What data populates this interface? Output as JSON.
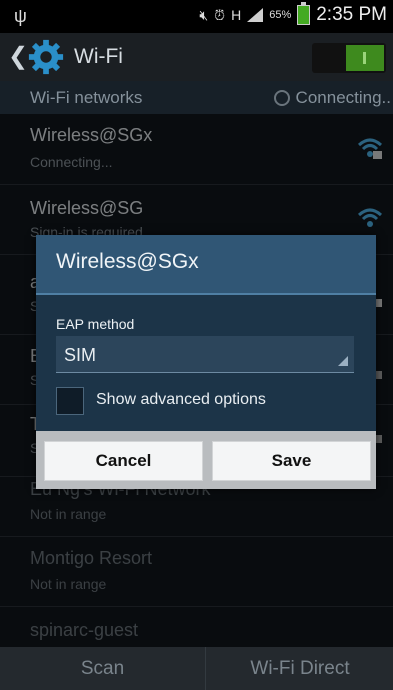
{
  "status_bar": {
    "battery_percent": "65%",
    "time": "2:35 PM",
    "signal_label": "H"
  },
  "title_bar": {
    "title": "Wi-Fi",
    "wifi_enabled": true
  },
  "section": {
    "label": "Wi-Fi networks",
    "status": "Connecting.."
  },
  "networks": [
    {
      "name": "Wireless@SGx",
      "sub": "Connecting...",
      "secured": true,
      "signal_color": "#4fb3e8"
    },
    {
      "name": "Wireless@SG",
      "sub": "Sign-in is required",
      "secured": false,
      "signal_color": "#4fb3e8"
    },
    {
      "name": "a",
      "sub": "S",
      "secured": true
    },
    {
      "name": "E",
      "sub": "S",
      "secured": true
    },
    {
      "name": "T",
      "sub": "S",
      "secured": true
    },
    {
      "name": "Eu Ng's Wi-Fi Network",
      "sub": "Not in range"
    },
    {
      "name": "Montigo Resort",
      "sub": "Not in range"
    },
    {
      "name": "spinarc-guest",
      "sub": ""
    }
  ],
  "dialog": {
    "title": "Wireless@SGx",
    "eap_label": "EAP method",
    "eap_value": "SIM",
    "advanced_label": "Show advanced options",
    "advanced_checked": false,
    "cancel_label": "Cancel",
    "save_label": "Save"
  },
  "bottom_bar": {
    "scan_label": "Scan",
    "direct_label": "Wi-Fi Direct"
  }
}
